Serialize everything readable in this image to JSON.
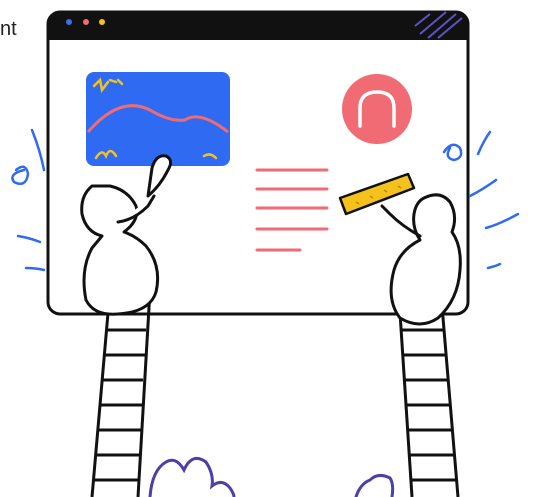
{
  "edge_text": "nt",
  "colors": {
    "ink": "#111111",
    "window_bar": "#111111",
    "dot_blue": "#3b6df0",
    "dot_red": "#f06b73",
    "dot_yellow": "#f5c21b",
    "image_panel": "#2f6bf2",
    "mountain_line": "#f06b73",
    "scribble_yellow": "#f5c21b",
    "avatar_circle": "#f06b73",
    "text_lines": "#f06b73",
    "brush_yellow": "#f5c21b",
    "swirl_blue": "#2f6bf2",
    "bush_purple": "#4b3fa8"
  },
  "icons": {
    "window": "browser-window-icon",
    "image": "image-placeholder-icon",
    "avatar": "user-avatar-icon",
    "text": "text-lines-icon"
  }
}
